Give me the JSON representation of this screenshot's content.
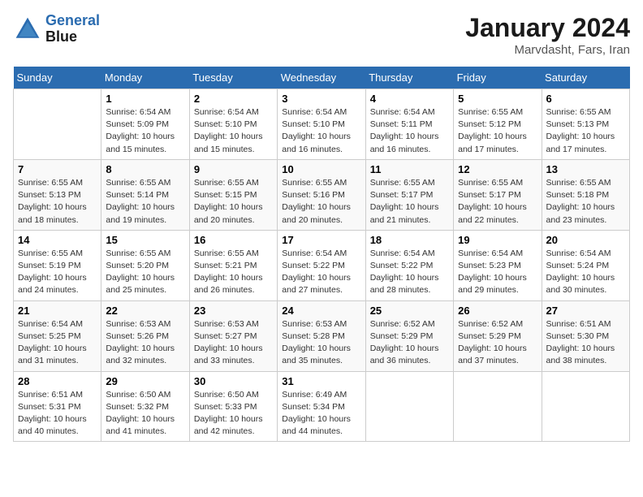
{
  "header": {
    "logo_line1": "General",
    "logo_line2": "Blue",
    "month": "January 2024",
    "location": "Marvdasht, Fars, Iran"
  },
  "weekdays": [
    "Sunday",
    "Monday",
    "Tuesday",
    "Wednesday",
    "Thursday",
    "Friday",
    "Saturday"
  ],
  "weeks": [
    [
      {
        "day": "",
        "sunrise": "",
        "sunset": "",
        "daylight": ""
      },
      {
        "day": "1",
        "sunrise": "Sunrise: 6:54 AM",
        "sunset": "Sunset: 5:09 PM",
        "daylight": "Daylight: 10 hours and 15 minutes."
      },
      {
        "day": "2",
        "sunrise": "Sunrise: 6:54 AM",
        "sunset": "Sunset: 5:10 PM",
        "daylight": "Daylight: 10 hours and 15 minutes."
      },
      {
        "day": "3",
        "sunrise": "Sunrise: 6:54 AM",
        "sunset": "Sunset: 5:10 PM",
        "daylight": "Daylight: 10 hours and 16 minutes."
      },
      {
        "day": "4",
        "sunrise": "Sunrise: 6:54 AM",
        "sunset": "Sunset: 5:11 PM",
        "daylight": "Daylight: 10 hours and 16 minutes."
      },
      {
        "day": "5",
        "sunrise": "Sunrise: 6:55 AM",
        "sunset": "Sunset: 5:12 PM",
        "daylight": "Daylight: 10 hours and 17 minutes."
      },
      {
        "day": "6",
        "sunrise": "Sunrise: 6:55 AM",
        "sunset": "Sunset: 5:13 PM",
        "daylight": "Daylight: 10 hours and 17 minutes."
      }
    ],
    [
      {
        "day": "7",
        "sunrise": "Sunrise: 6:55 AM",
        "sunset": "Sunset: 5:13 PM",
        "daylight": "Daylight: 10 hours and 18 minutes."
      },
      {
        "day": "8",
        "sunrise": "Sunrise: 6:55 AM",
        "sunset": "Sunset: 5:14 PM",
        "daylight": "Daylight: 10 hours and 19 minutes."
      },
      {
        "day": "9",
        "sunrise": "Sunrise: 6:55 AM",
        "sunset": "Sunset: 5:15 PM",
        "daylight": "Daylight: 10 hours and 20 minutes."
      },
      {
        "day": "10",
        "sunrise": "Sunrise: 6:55 AM",
        "sunset": "Sunset: 5:16 PM",
        "daylight": "Daylight: 10 hours and 20 minutes."
      },
      {
        "day": "11",
        "sunrise": "Sunrise: 6:55 AM",
        "sunset": "Sunset: 5:17 PM",
        "daylight": "Daylight: 10 hours and 21 minutes."
      },
      {
        "day": "12",
        "sunrise": "Sunrise: 6:55 AM",
        "sunset": "Sunset: 5:17 PM",
        "daylight": "Daylight: 10 hours and 22 minutes."
      },
      {
        "day": "13",
        "sunrise": "Sunrise: 6:55 AM",
        "sunset": "Sunset: 5:18 PM",
        "daylight": "Daylight: 10 hours and 23 minutes."
      }
    ],
    [
      {
        "day": "14",
        "sunrise": "Sunrise: 6:55 AM",
        "sunset": "Sunset: 5:19 PM",
        "daylight": "Daylight: 10 hours and 24 minutes."
      },
      {
        "day": "15",
        "sunrise": "Sunrise: 6:55 AM",
        "sunset": "Sunset: 5:20 PM",
        "daylight": "Daylight: 10 hours and 25 minutes."
      },
      {
        "day": "16",
        "sunrise": "Sunrise: 6:55 AM",
        "sunset": "Sunset: 5:21 PM",
        "daylight": "Daylight: 10 hours and 26 minutes."
      },
      {
        "day": "17",
        "sunrise": "Sunrise: 6:54 AM",
        "sunset": "Sunset: 5:22 PM",
        "daylight": "Daylight: 10 hours and 27 minutes."
      },
      {
        "day": "18",
        "sunrise": "Sunrise: 6:54 AM",
        "sunset": "Sunset: 5:22 PM",
        "daylight": "Daylight: 10 hours and 28 minutes."
      },
      {
        "day": "19",
        "sunrise": "Sunrise: 6:54 AM",
        "sunset": "Sunset: 5:23 PM",
        "daylight": "Daylight: 10 hours and 29 minutes."
      },
      {
        "day": "20",
        "sunrise": "Sunrise: 6:54 AM",
        "sunset": "Sunset: 5:24 PM",
        "daylight": "Daylight: 10 hours and 30 minutes."
      }
    ],
    [
      {
        "day": "21",
        "sunrise": "Sunrise: 6:54 AM",
        "sunset": "Sunset: 5:25 PM",
        "daylight": "Daylight: 10 hours and 31 minutes."
      },
      {
        "day": "22",
        "sunrise": "Sunrise: 6:53 AM",
        "sunset": "Sunset: 5:26 PM",
        "daylight": "Daylight: 10 hours and 32 minutes."
      },
      {
        "day": "23",
        "sunrise": "Sunrise: 6:53 AM",
        "sunset": "Sunset: 5:27 PM",
        "daylight": "Daylight: 10 hours and 33 minutes."
      },
      {
        "day": "24",
        "sunrise": "Sunrise: 6:53 AM",
        "sunset": "Sunset: 5:28 PM",
        "daylight": "Daylight: 10 hours and 35 minutes."
      },
      {
        "day": "25",
        "sunrise": "Sunrise: 6:52 AM",
        "sunset": "Sunset: 5:29 PM",
        "daylight": "Daylight: 10 hours and 36 minutes."
      },
      {
        "day": "26",
        "sunrise": "Sunrise: 6:52 AM",
        "sunset": "Sunset: 5:29 PM",
        "daylight": "Daylight: 10 hours and 37 minutes."
      },
      {
        "day": "27",
        "sunrise": "Sunrise: 6:51 AM",
        "sunset": "Sunset: 5:30 PM",
        "daylight": "Daylight: 10 hours and 38 minutes."
      }
    ],
    [
      {
        "day": "28",
        "sunrise": "Sunrise: 6:51 AM",
        "sunset": "Sunset: 5:31 PM",
        "daylight": "Daylight: 10 hours and 40 minutes."
      },
      {
        "day": "29",
        "sunrise": "Sunrise: 6:50 AM",
        "sunset": "Sunset: 5:32 PM",
        "daylight": "Daylight: 10 hours and 41 minutes."
      },
      {
        "day": "30",
        "sunrise": "Sunrise: 6:50 AM",
        "sunset": "Sunset: 5:33 PM",
        "daylight": "Daylight: 10 hours and 42 minutes."
      },
      {
        "day": "31",
        "sunrise": "Sunrise: 6:49 AM",
        "sunset": "Sunset: 5:34 PM",
        "daylight": "Daylight: 10 hours and 44 minutes."
      },
      {
        "day": "",
        "sunrise": "",
        "sunset": "",
        "daylight": ""
      },
      {
        "day": "",
        "sunrise": "",
        "sunset": "",
        "daylight": ""
      },
      {
        "day": "",
        "sunrise": "",
        "sunset": "",
        "daylight": ""
      }
    ]
  ]
}
